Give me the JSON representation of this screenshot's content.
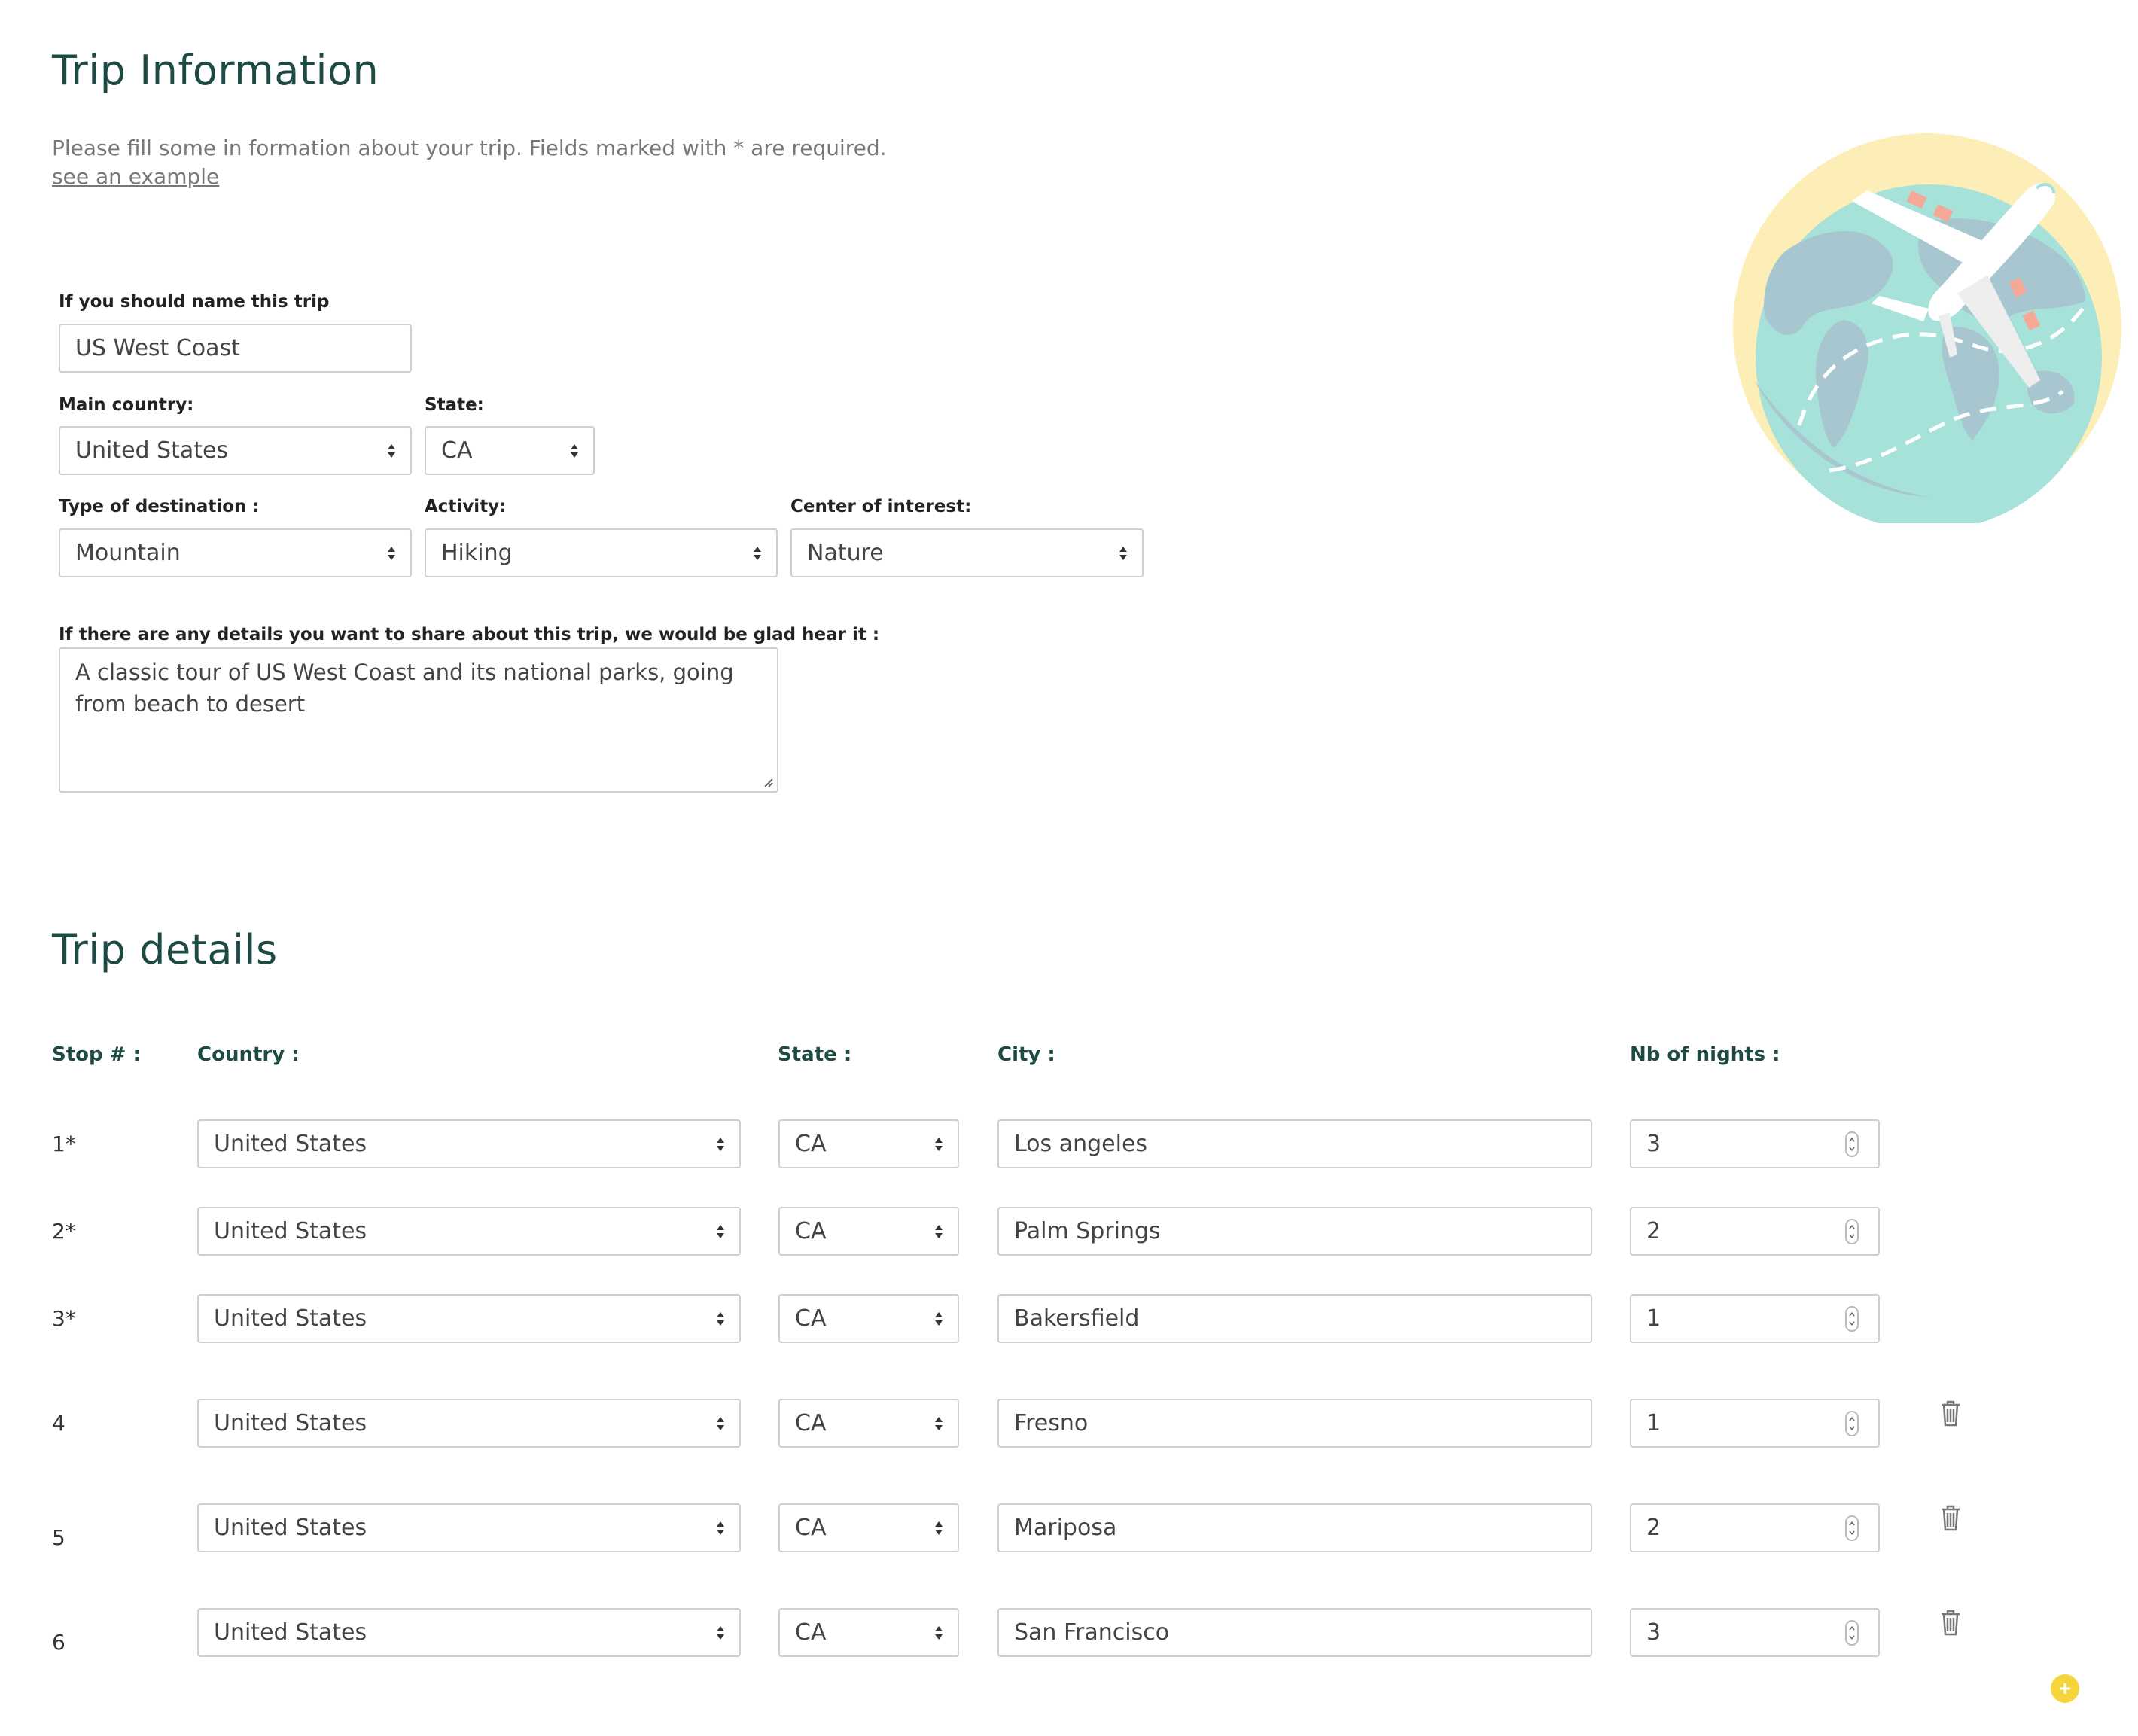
{
  "trip_info": {
    "title": "Trip Information",
    "intro": "Please fill some in formation about your trip. Fields marked with * are required.",
    "example_link": "see an example",
    "name_label": "If you should name this trip",
    "name_value": "US West Coast",
    "country_label": "Main country:",
    "country_value": "United States",
    "state_label": "State:",
    "state_value": "CA",
    "destination_label": "Type of destination :",
    "destination_value": "Mountain",
    "activity_label": "Activity:",
    "activity_value": "Hiking",
    "interest_label": "Center of interest:",
    "interest_value": "Nature",
    "details_label": "If there are any details you want to share about this trip, we would be glad hear it :",
    "details_value": " A classic tour of US West Coast and its national parks, going from beach to desert"
  },
  "trip_details": {
    "title": "Trip details",
    "headers": {
      "stop": "Stop # :",
      "country": "Country :",
      "state": "State :",
      "city": "City :",
      "nights": "Nb of nights :"
    },
    "stops": [
      {
        "num": "1*",
        "country": "United States",
        "state": "CA",
        "city": "Los angeles",
        "nights": "3"
      },
      {
        "num": "2*",
        "country": "United States",
        "state": "CA",
        "city": "Palm Springs",
        "nights": "2"
      },
      {
        "num": "3*",
        "country": "United States",
        "state": "CA",
        "city": "Bakersfield",
        "nights": "1"
      },
      {
        "num": "4",
        "country": "United States",
        "state": "CA",
        "city": "Fresno",
        "nights": "1"
      },
      {
        "num": "5",
        "country": "United States",
        "state": "CA",
        "city": "Mariposa",
        "nights": "2"
      },
      {
        "num": "6",
        "country": "United States",
        "state": "CA",
        "city": "San Francisco",
        "nights": "3"
      }
    ]
  },
  "colors": {
    "heading": "#1e4a44",
    "accent_yellow": "#f6d43b",
    "globe_bg": "#fdeeb8",
    "globe_water": "#a7e2da",
    "globe_land": "#a8c6cf"
  },
  "icons": {
    "hero": "globe-airplane-illustration",
    "delete": "trash-icon",
    "add": "plus-circle-icon",
    "select": "updown-arrows-icon",
    "spinner": "number-spinner-icon"
  }
}
